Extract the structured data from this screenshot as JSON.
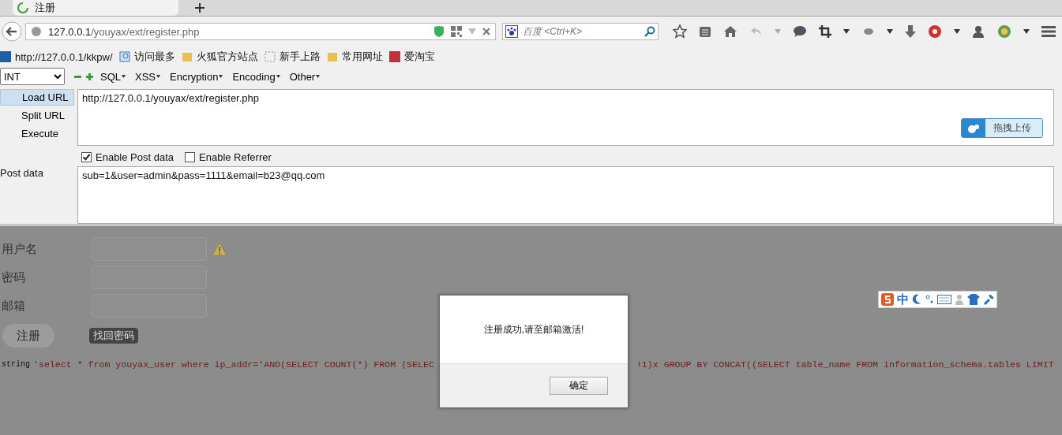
{
  "tab": {
    "title": "注册"
  },
  "address_bar": {
    "host": "127.0.0.1",
    "path": "/youyax/ext/register.php"
  },
  "search": {
    "placeholder": "百度 <Ctrl+K>"
  },
  "bookmarks": [
    {
      "label": "http://127.0.0.1/kkpw/",
      "kind": "site"
    },
    {
      "label": "访问最多",
      "kind": "search"
    },
    {
      "label": "火狐官方站点",
      "kind": "folder"
    },
    {
      "label": "新手上路",
      "kind": "blank"
    },
    {
      "label": "常用网址",
      "kind": "folder"
    },
    {
      "label": "爱淘宝",
      "kind": "taobao"
    }
  ],
  "hackbar": {
    "encoding": "INT",
    "menus": [
      "SQL",
      "XSS",
      "Encryption",
      "Encoding",
      "Other"
    ],
    "actions": [
      {
        "label": "Load URL",
        "selected": true
      },
      {
        "label": "Split URL",
        "selected": false
      },
      {
        "label": "Execute",
        "selected": false
      }
    ],
    "url": "http://127.0.0.1/youyax/ext/register.php",
    "upload_button": "拖拽上传",
    "options": [
      {
        "label": "Enable Post data",
        "checked": true
      },
      {
        "label": "Enable Referrer",
        "checked": false
      }
    ],
    "post_label": "Post data",
    "post_data": "sub=1&user=admin&pass=1111&email=b23@qq.com"
  },
  "form": {
    "fields": [
      {
        "label": "用户名",
        "warning": true
      },
      {
        "label": "密码",
        "warning": false
      },
      {
        "label": "邮箱",
        "warning": false
      }
    ],
    "register_button": "注册",
    "recover_link": "找回密码"
  },
  "debug": {
    "type": "string",
    "text_before": "'select * from youyax_user where ip_addr='AND(SELECT COUNT(*) FROM (SELEC",
    "text_after": "!1)x GROUP BY CONCAT((SELECT table_name FROM information_schema.tables LIMIT"
  },
  "ime_bar": {
    "mode": "中"
  },
  "dialog": {
    "message": "注册成功,请至邮箱激活!",
    "ok": "确定"
  }
}
